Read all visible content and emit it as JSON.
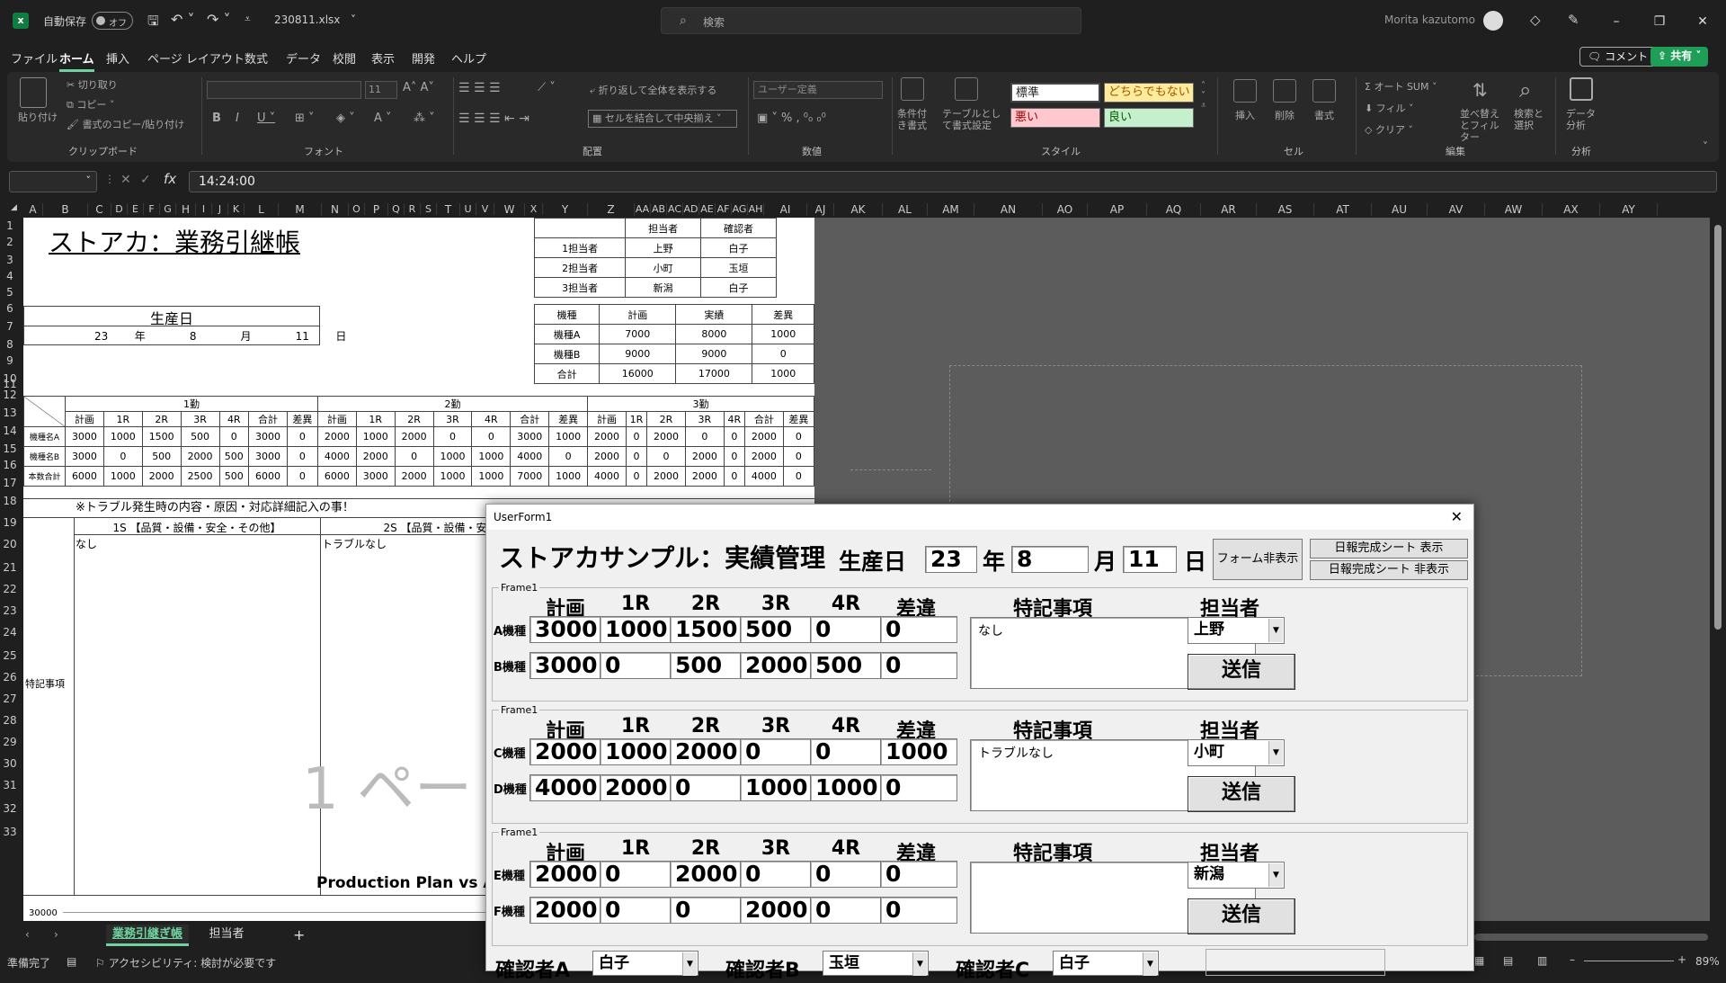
{
  "titlebar": {
    "app_icon": "excel-icon",
    "autosave_label": "自動保存",
    "autosave_state": "オフ",
    "filename": "230811.xlsx",
    "search_placeholder": "検索",
    "user": "Morita kazutomo"
  },
  "menu": {
    "items": [
      "ファイル",
      "ホーム",
      "挿入",
      "ページ レイアウト",
      "数式",
      "データ",
      "校閲",
      "表示",
      "開発",
      "ヘルプ"
    ],
    "active": "ホーム",
    "comment_btn": "コメント",
    "share_btn": "共有"
  },
  "ribbon": {
    "clipboard": {
      "label": "クリップボード",
      "paste": "貼り付け",
      "cut": "切り取り",
      "copy": "コピー",
      "format_painter": "書式のコピー/貼り付け"
    },
    "font": {
      "label": "フォント",
      "size": "11"
    },
    "alignment": {
      "label": "配置",
      "wrap": "折り返して全体を表示する",
      "merge": "セルを結合して中央揃え"
    },
    "number": {
      "label": "数値",
      "format": "ユーザー定義"
    },
    "styles": {
      "label": "スタイル",
      "cond": "条件付き書式",
      "table": "テーブルとして書式設定",
      "cells": [
        "標準",
        "どちらでもない",
        "悪い",
        "良い"
      ]
    },
    "cells": {
      "label": "セル",
      "insert": "挿入",
      "delete": "削除",
      "format": "書式"
    },
    "edit": {
      "label": "編集",
      "autosum": "オート SUM",
      "fill": "フィル",
      "clear": "クリア",
      "sort": "並べ替えとフィルター",
      "find": "検索と選択"
    },
    "analysis": {
      "label": "分析",
      "data": "データ分析"
    }
  },
  "formula": {
    "value": "14:24:00"
  },
  "columns": [
    "A",
    "B",
    "C",
    "D",
    "E",
    "F",
    "G",
    "H",
    "I",
    "J",
    "K",
    "L",
    "M",
    "N",
    "O",
    "P",
    "Q",
    "R",
    "S",
    "T",
    "U",
    "V",
    "W",
    "X",
    "Y",
    "Z",
    "AA",
    "AB",
    "AC",
    "AD",
    "AE",
    "AF",
    "AG",
    "AH",
    "AI",
    "AJ",
    "AK",
    "AL",
    "AM",
    "AN",
    "AO",
    "AP",
    "AQ",
    "AR",
    "AS",
    "AT",
    "AU",
    "AV",
    "AW",
    "AX",
    "AY"
  ],
  "rows": [
    "1",
    "2",
    "3",
    "4",
    "5",
    "6",
    "7",
    "8",
    "9",
    "10",
    "11",
    "12",
    "13",
    "14",
    "15",
    "16",
    "17",
    "18",
    "19",
    "20",
    "21",
    "22",
    "23",
    "24",
    "25",
    "26",
    "27",
    "28",
    "29",
    "30",
    "31",
    "32",
    "33"
  ],
  "sheet": {
    "title": "ストアカ：業務引継帳",
    "staff_table": {
      "headers": [
        "",
        "担当者",
        "確認者"
      ],
      "rows": [
        [
          "1担当者",
          "上野",
          "白子"
        ],
        [
          "2担当者",
          "小町",
          "玉垣"
        ],
        [
          "3担当者",
          "新潟",
          "白子"
        ]
      ]
    },
    "prod_date": {
      "label": "生産日",
      "year": "23",
      "year_u": "年",
      "month": "8",
      "month_u": "月",
      "day": "11",
      "day_u": "日"
    },
    "summary": {
      "headers": [
        "機種",
        "計画",
        "実績",
        "差異"
      ],
      "rows": [
        [
          "機種A",
          "7000",
          "8000",
          "1000"
        ],
        [
          "機種B",
          "9000",
          "9000",
          "0"
        ],
        [
          "合計",
          "16000",
          "17000",
          "1000"
        ]
      ]
    },
    "shifts": [
      "1勤",
      "2勤",
      "3勤"
    ],
    "shift_cols": [
      "計画",
      "1R",
      "2R",
      "3R",
      "4R",
      "合計",
      "差異"
    ],
    "data_rows": [
      {
        "label": "機種名A",
        "v": [
          "3000",
          "1000",
          "1500",
          "500",
          "0",
          "3000",
          "0",
          "2000",
          "1000",
          "2000",
          "0",
          "0",
          "3000",
          "1000",
          "2000",
          "0",
          "2000",
          "0",
          "0",
          "2000",
          "0"
        ]
      },
      {
        "label": "機種名B",
        "v": [
          "3000",
          "0",
          "500",
          "2000",
          "500",
          "3000",
          "0",
          "4000",
          "2000",
          "0",
          "1000",
          "1000",
          "4000",
          "0",
          "2000",
          "0",
          "0",
          "2000",
          "0",
          "2000",
          "0"
        ]
      },
      {
        "label": "本数合計",
        "v": [
          "6000",
          "1000",
          "2000",
          "2500",
          "500",
          "6000",
          "0",
          "6000",
          "3000",
          "2000",
          "1000",
          "1000",
          "7000",
          "1000",
          "4000",
          "0",
          "2000",
          "2000",
          "0",
          "4000",
          "0"
        ]
      }
    ],
    "trouble_note": "※トラブル発生時の内容・原因・対応詳細記入の事！",
    "s1_header": "1S 【品質・設備・安全・その他】",
    "s2_header": "2S 【品質・設備・安全・",
    "s1_text": "なし",
    "s2_text": "トラブルなし",
    "notes_label": "特記事項",
    "page_watermark": "1 ペー",
    "chart_title": "Production Plan vs Ac",
    "chart_axis_top": "30000"
  },
  "tabs": {
    "items": [
      "業務引継ぎ帳",
      "担当者"
    ],
    "active": "業務引継ぎ帳"
  },
  "status": {
    "ready": "準備完了",
    "accessibility": "アクセシビリティ: 検討が必要です",
    "zoom": "89%"
  },
  "userform": {
    "title": "UserForm1",
    "heading": "ストアカサンプル：実績管理",
    "date_label": "生産日",
    "year": "23",
    "year_u": "年",
    "month": "8",
    "month_u": "月",
    "day": "11",
    "day_u": "日",
    "hide_form": "フォーム非表示",
    "show_daily": "日報完成シート  表示",
    "hide_daily": "日報完成シート  非表示",
    "col_headers": [
      "計画",
      "1R",
      "2R",
      "3R",
      "4R",
      "差違"
    ],
    "notes_header": "特記事項",
    "staff_header": "担当者",
    "send": "送信",
    "frames": [
      {
        "label": "Frame1",
        "rows": [
          {
            "label": "A機種",
            "v": [
              "3000",
              "1000",
              "1500",
              "500",
              "0",
              "0"
            ]
          },
          {
            "label": "B機種",
            "v": [
              "3000",
              "0",
              "500",
              "2000",
              "500",
              "0"
            ]
          }
        ],
        "notes": "なし",
        "staff": "上野"
      },
      {
        "label": "Frame1",
        "rows": [
          {
            "label": "C機種",
            "v": [
              "2000",
              "1000",
              "2000",
              "0",
              "0",
              "1000"
            ]
          },
          {
            "label": "D機種",
            "v": [
              "4000",
              "2000",
              "0",
              "1000",
              "1000",
              "0"
            ]
          }
        ],
        "notes": "トラブルなし",
        "staff": "小町"
      },
      {
        "label": "Frame1",
        "rows": [
          {
            "label": "E機種",
            "v": [
              "2000",
              "0",
              "2000",
              "0",
              "0",
              "0"
            ]
          },
          {
            "label": "F機種",
            "v": [
              "2000",
              "0",
              "0",
              "2000",
              "0",
              "0"
            ]
          }
        ],
        "notes": "",
        "staff": "新潟"
      }
    ],
    "checkers": [
      {
        "label": "確認者A",
        "value": "白子"
      },
      {
        "label": "確認者B",
        "value": "玉垣"
      },
      {
        "label": "確認者C",
        "value": "白子"
      }
    ]
  }
}
